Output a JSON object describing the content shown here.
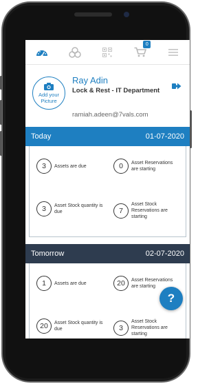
{
  "nav": {
    "items": [
      {
        "name": "dashboard-icon",
        "active": true
      },
      {
        "name": "assets-icon",
        "active": false
      },
      {
        "name": "qr-scan-icon",
        "active": false
      },
      {
        "name": "cart-icon",
        "active": false,
        "badge": "0"
      },
      {
        "name": "menu-icon",
        "active": false
      }
    ]
  },
  "profile": {
    "add_picture_label": "Add your Picture",
    "name": "Ray Adin",
    "department": "Lock & Rest - IT Department",
    "email": "ramiah.adeen@7vals.com"
  },
  "today": {
    "title": "Today",
    "date": "01-07-2020",
    "header_color": "#1e7fc1",
    "stats": [
      {
        "count": "3",
        "label": "Assets are due"
      },
      {
        "count": "0",
        "label": "Asset Reservations are starting"
      },
      {
        "count": "3",
        "label": "Asset Stock quantity is due"
      },
      {
        "count": "7",
        "label": "Asset Stock Reservations are starting"
      }
    ]
  },
  "tomorrow": {
    "title": "Tomorrow",
    "date": "02-07-2020",
    "header_color": "#2e3c4f",
    "stats": [
      {
        "count": "1",
        "label": "Assets are due"
      },
      {
        "count": "20",
        "label": "Asset Reservations are starting"
      },
      {
        "count": "20",
        "label": "Asset Stock quantity is due"
      },
      {
        "count": "3",
        "label": "Asset Stock Reservations are starting"
      }
    ]
  },
  "help": {
    "label": "?"
  }
}
